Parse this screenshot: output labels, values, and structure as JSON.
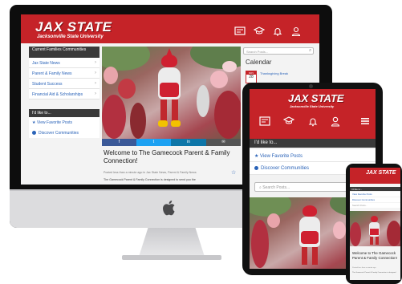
{
  "brand": {
    "name": "JAX STATE",
    "subtitle": "Jacksonville State University",
    "primary_color": "#c52328",
    "dark_color": "#3a3a3a",
    "link_color": "#2a63b8"
  },
  "header_icons": [
    "dashboard-icon",
    "graduation-cap-icon",
    "bell-icon",
    "user-icon"
  ],
  "desktop": {
    "sidebar_title": "Current Families Communities",
    "sidebar_items": [
      {
        "label": "Jax State News"
      },
      {
        "label": "Parent & Family News"
      },
      {
        "label": "Student Success"
      },
      {
        "label": "Financial Aid & Scholarships"
      }
    ],
    "like_title": "I'd like to...",
    "like_items": [
      {
        "label": "View Favorite Posts",
        "icon": "star-icon"
      },
      {
        "label": "Discover Communities",
        "icon": "check-circle-icon"
      }
    ],
    "search_placeholder": "Search Posts...",
    "calendar_title": "Calendar",
    "calendar_event": {
      "month": "NOV",
      "day": "28",
      "title": "Thanksgiving Break"
    },
    "share_buttons": [
      "f",
      "t",
      "in",
      "✉"
    ],
    "post_title": "Welcome to The Gamecock Parent & Family Connection!",
    "post_meta": "Posted less than a minute ago in Jax State News, Parent & Family News",
    "post_intro": "The Gamecock Parent & Family Connection is designed to send you the"
  },
  "tablet": {
    "like_title": "I'd like to...",
    "like_items": [
      {
        "label": "View Favorite Posts",
        "icon": "star-icon"
      },
      {
        "label": "Discover Communities",
        "icon": "check-circle-icon"
      }
    ],
    "search_placeholder": "Search Posts...",
    "menu_icon": "hamburger-menu-icon"
  },
  "phone": {
    "like_title": "I'd like to...",
    "like_items": [
      {
        "label": "View Favorite Posts"
      },
      {
        "label": "Discover Communities"
      },
      {
        "label": "Search Posts..."
      }
    ],
    "post_title": "Welcome to The Gamecock Parent & Family Connection!",
    "post_meta": "Posted less than a minute ago",
    "post_intro": "The Gamecock Parent & Family Connection is designed"
  }
}
